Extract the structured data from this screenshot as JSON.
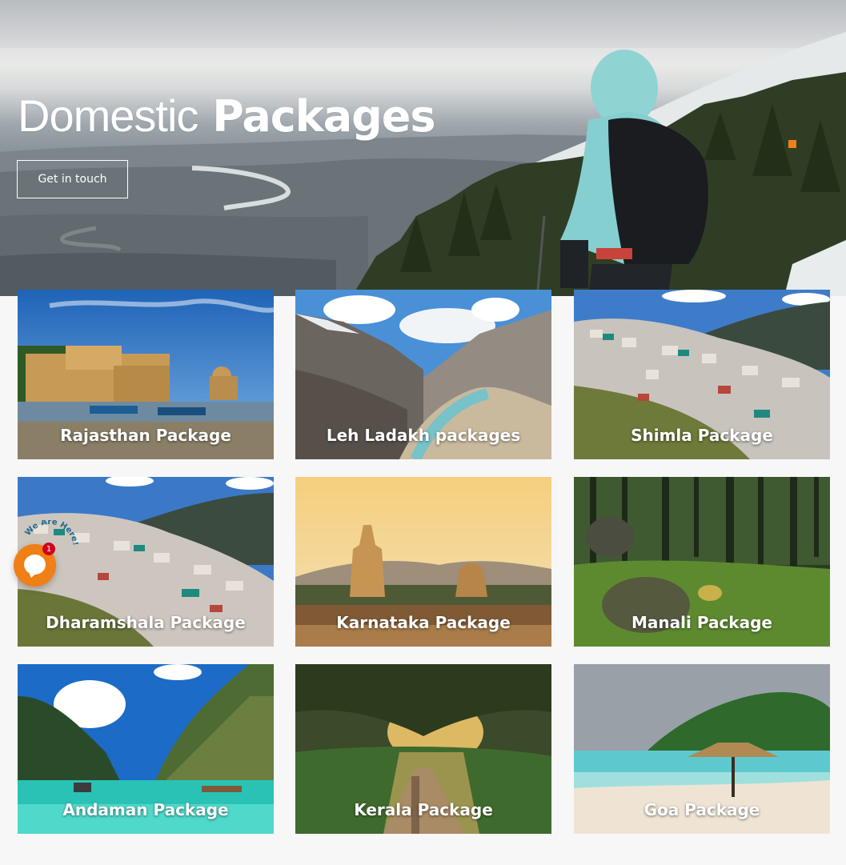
{
  "hero": {
    "title_light": "Domestic",
    "title_bold": "Packages",
    "cta_label": "Get in touch"
  },
  "packages": [
    {
      "label": "Rajasthan Package"
    },
    {
      "label": "Leh Ladakh packages"
    },
    {
      "label": "Shimla Package"
    },
    {
      "label": "Dharamshala Package"
    },
    {
      "label": "Karnataka Package"
    },
    {
      "label": "Manali Package"
    },
    {
      "label": "Andaman Package"
    },
    {
      "label": "Kerala Package"
    },
    {
      "label": "Goa Package"
    }
  ],
  "chat_widget": {
    "tag_text": "We Are Here!",
    "badge_count": "1",
    "icon": "chat-bubble-icon"
  },
  "colors": {
    "accent": "#f07f15",
    "badge": "#d0021b",
    "background": "#f7f7f7"
  }
}
